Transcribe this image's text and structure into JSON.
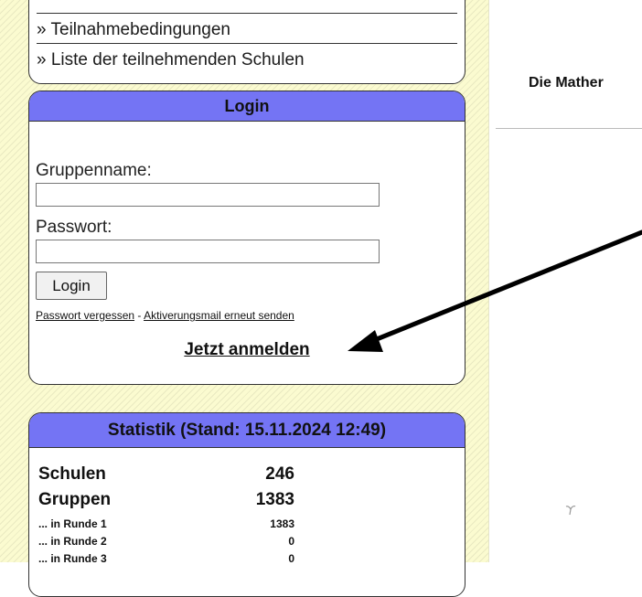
{
  "links": {
    "items": [
      "» Teilnahmebedingungen",
      "» Liste der teilnehmenden Schulen"
    ]
  },
  "login": {
    "title": "Login",
    "group_label": "Gruppenname:",
    "group_value": "",
    "password_label": "Passwort:",
    "password_value": "",
    "button_label": "Login",
    "forgot_label": "Passwort vergessen",
    "separator": " - ",
    "resend_label": "Aktiverungsmail erneut senden",
    "signup_label": "Jetzt anmelden"
  },
  "stats": {
    "title": "Statistik (Stand: 15.11.2024 12:49)",
    "rows": [
      {
        "label": "Schulen",
        "value": "246"
      },
      {
        "label": "Gruppen",
        "value": "1383"
      },
      {
        "label": "... in Runde 1",
        "value": "1383"
      },
      {
        "label": "... in Runde 2",
        "value": "0"
      },
      {
        "label": "... in Runde 3",
        "value": "0"
      }
    ]
  },
  "main": {
    "title": "Die Mather"
  },
  "colors": {
    "sidebar": "#fbfbd0",
    "box_header": "#7474f4",
    "arrow": "#000000"
  }
}
